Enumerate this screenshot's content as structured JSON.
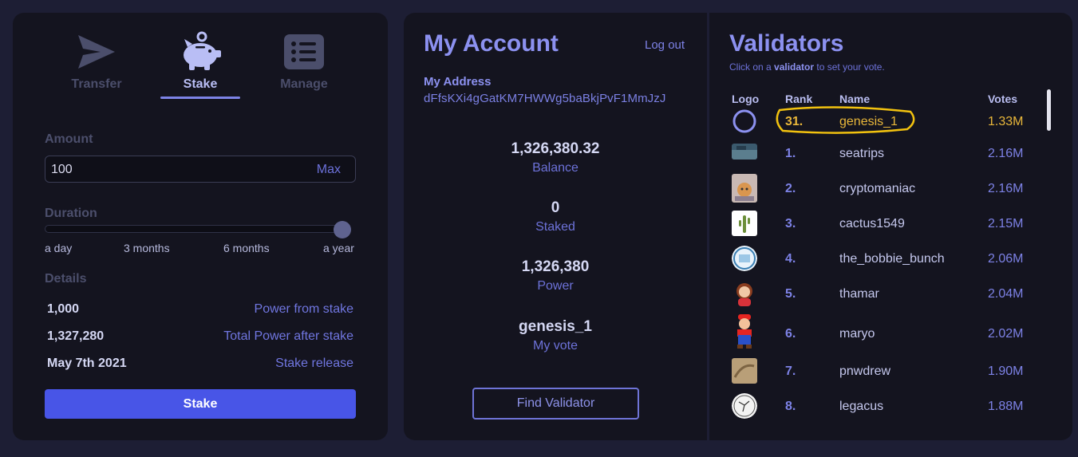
{
  "tabs": [
    {
      "label": "Transfer",
      "icon": "send-icon",
      "active": false
    },
    {
      "label": "Stake",
      "icon": "piggy-bank-icon",
      "active": true
    },
    {
      "label": "Manage",
      "icon": "list-icon",
      "active": false
    }
  ],
  "stake": {
    "amount_label": "Amount",
    "amount_value": "100",
    "max_label": "Max",
    "duration_label": "Duration",
    "duration_level": 1.0,
    "duration_ticks": [
      "a day",
      "3 months",
      "6 months",
      "a year"
    ],
    "details_label": "Details",
    "details": [
      {
        "value": "1,000",
        "key": "Power from stake"
      },
      {
        "value": "1,327,280",
        "key": "Total Power after stake"
      },
      {
        "value": "May 7th 2021",
        "key": "Stake release"
      }
    ],
    "button_label": "Stake"
  },
  "account": {
    "title": "My Account",
    "logout_label": "Log out",
    "address_label": "My Address",
    "address": "dFfsKXi4gGatKM7HWWg5baBkjPvF1MmJzJ",
    "stats": [
      {
        "value": "1,326,380.32",
        "label": "Balance"
      },
      {
        "value": "0",
        "label": "Staked"
      },
      {
        "value": "1,326,380",
        "label": "Power"
      },
      {
        "value": "genesis_1",
        "label": "My vote"
      }
    ],
    "find_button": "Find Validator"
  },
  "validators": {
    "title": "Validators",
    "hint_prefix": "Click on a",
    "hint_bold": "validator",
    "hint_suffix": "to set your vote.",
    "columns": [
      "Logo",
      "Rank",
      "Name",
      "Votes"
    ],
    "rows": [
      {
        "rank": "31.",
        "name": "genesis_1",
        "votes": "1.33M",
        "mine": true,
        "logo": "ring"
      },
      {
        "rank": "1.",
        "name": "seatrips",
        "votes": "2.16M",
        "logo": "photo-sea"
      },
      {
        "rank": "2.",
        "name": "cryptomaniac",
        "votes": "2.16M",
        "logo": "photo-cat"
      },
      {
        "rank": "3.",
        "name": "cactus1549",
        "votes": "2.15M",
        "logo": "cactus"
      },
      {
        "rank": "4.",
        "name": "the_bobbie_bunch",
        "votes": "2.06M",
        "logo": "badge-blue"
      },
      {
        "rank": "5.",
        "name": "thamar",
        "votes": "2.04M",
        "logo": "avatar-woman"
      },
      {
        "rank": "6.",
        "name": "maryo",
        "votes": "2.02M",
        "logo": "plumber"
      },
      {
        "rank": "7.",
        "name": "pnwdrew",
        "votes": "1.90M",
        "logo": "photo-sand"
      },
      {
        "rank": "8.",
        "name": "legacus",
        "votes": "1.88M",
        "logo": "constellation"
      }
    ],
    "highlight_color": "#f2c20f"
  }
}
